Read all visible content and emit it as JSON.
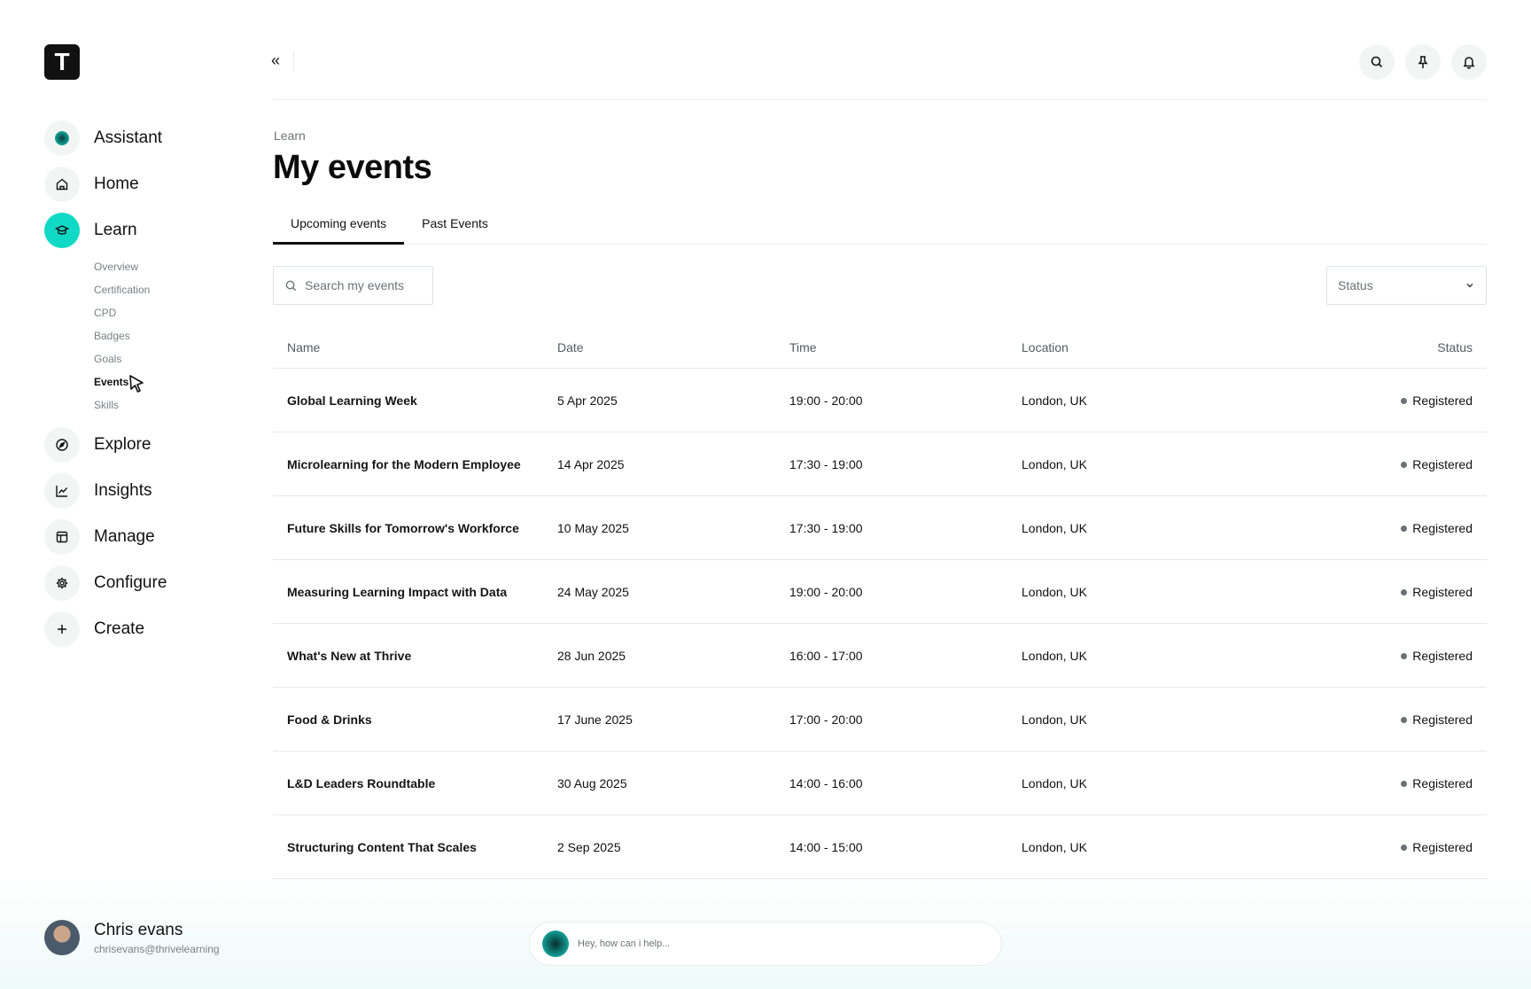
{
  "app": {
    "logo_letter": "T",
    "accent_color": "#10d9c5"
  },
  "sidebar": {
    "items": [
      {
        "label": "Assistant",
        "icon": "assistant-orb-icon"
      },
      {
        "label": "Home",
        "icon": "home-icon"
      },
      {
        "label": "Learn",
        "icon": "graduation-cap-icon",
        "active": true
      },
      {
        "label": "Explore",
        "icon": "compass-icon"
      },
      {
        "label": "Insights",
        "icon": "chart-line-icon"
      },
      {
        "label": "Manage",
        "icon": "layout-icon"
      },
      {
        "label": "Configure",
        "icon": "gear-icon"
      },
      {
        "label": "Create",
        "icon": "plus-icon"
      }
    ],
    "learn_subitems": [
      "Overview",
      "Certification",
      "CPD",
      "Badges",
      "Goals",
      "Events",
      "Skills"
    ],
    "active_subitem": "Events"
  },
  "user": {
    "name": "Chris evans",
    "email": "chrisevans@thrivelearning"
  },
  "topbar": {
    "collapse_glyph": "«",
    "actions": [
      "search-icon",
      "pin-icon",
      "bell-icon"
    ]
  },
  "header": {
    "breadcrumb": "Learn",
    "title": "My events"
  },
  "tabs": [
    {
      "label": "Upcoming events",
      "active": true
    },
    {
      "label": "Past Events",
      "active": false
    }
  ],
  "filters": {
    "search_placeholder": "Search my events",
    "status_label": "Status"
  },
  "table": {
    "columns": [
      "Name",
      "Date",
      "Time",
      "Location",
      "Status"
    ],
    "rows": [
      {
        "name": "Global Learning Week",
        "date": "5 Apr 2025",
        "time": "19:00 - 20:00",
        "location": "London, UK",
        "status": "Registered"
      },
      {
        "name": "Microlearning for the Modern Employee",
        "date": "14 Apr 2025",
        "time": "17:30 - 19:00",
        "location": "London, UK",
        "status": "Registered"
      },
      {
        "name": "Future Skills for Tomorrow's Workforce",
        "date": "10 May 2025",
        "time": "17:30 - 19:00",
        "location": "London, UK",
        "status": "Registered"
      },
      {
        "name": "Measuring Learning Impact with Data",
        "date": "24 May 2025",
        "time": "19:00 - 20:00",
        "location": "London, UK",
        "status": "Registered"
      },
      {
        "name": "What's New at Thrive",
        "date": "28 Jun 2025",
        "time": "16:00 - 17:00",
        "location": "London, UK",
        "status": "Registered"
      },
      {
        "name": "Food & Drinks",
        "date": "17 June 2025",
        "time": "17:00 - 20:00",
        "location": "London, UK",
        "status": "Registered"
      },
      {
        "name": "L&D Leaders Roundtable",
        "date": "30 Aug 2025",
        "time": "14:00 - 16:00",
        "location": "London, UK",
        "status": "Registered"
      },
      {
        "name": "Structuring Content That Scales",
        "date": "2 Sep 2025",
        "time": "14:00 - 15:00",
        "location": "London, UK",
        "status": "Registered"
      }
    ]
  },
  "assistant": {
    "placeholder": "Hey, how can i help..."
  }
}
